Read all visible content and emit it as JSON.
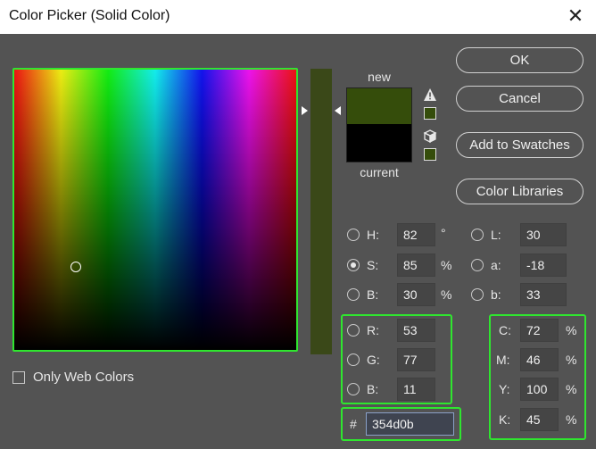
{
  "window": {
    "title": "Color Picker (Solid Color)",
    "close_glyph": "✕"
  },
  "preview": {
    "new_label": "new",
    "current_label": "current",
    "new_color": "#354d0b",
    "current_color": "#000000"
  },
  "buttons": {
    "ok": "OK",
    "cancel": "Cancel",
    "add_to_swatches": "Add to Swatches",
    "color_libraries": "Color Libraries"
  },
  "hsb": {
    "h": {
      "label": "H:",
      "value": "82",
      "unit": "°"
    },
    "s": {
      "label": "S:",
      "value": "85",
      "unit": "%"
    },
    "b": {
      "label": "B:",
      "value": "30",
      "unit": "%"
    }
  },
  "lab": {
    "l": {
      "label": "L:",
      "value": "30"
    },
    "a": {
      "label": "a:",
      "value": "-18"
    },
    "b": {
      "label": "b:",
      "value": "33"
    }
  },
  "rgb": {
    "r": {
      "label": "R:",
      "value": "53"
    },
    "g": {
      "label": "G:",
      "value": "77"
    },
    "b": {
      "label": "B:",
      "value": "11"
    }
  },
  "hex": {
    "label": "#",
    "value": "354d0b"
  },
  "cmyk": {
    "c": {
      "label": "C:",
      "value": "72",
      "unit": "%"
    },
    "m": {
      "label": "M:",
      "value": "46",
      "unit": "%"
    },
    "y": {
      "label": "Y:",
      "value": "100",
      "unit": "%"
    },
    "k": {
      "label": "K:",
      "value": "45",
      "unit": "%"
    }
  },
  "only_web_colors": {
    "label": "Only Web Colors",
    "checked": false
  },
  "icons": {
    "gamut_warning": "warning-triangle-icon",
    "web_safe": "cube-icon"
  },
  "accent": "#2fe62f"
}
